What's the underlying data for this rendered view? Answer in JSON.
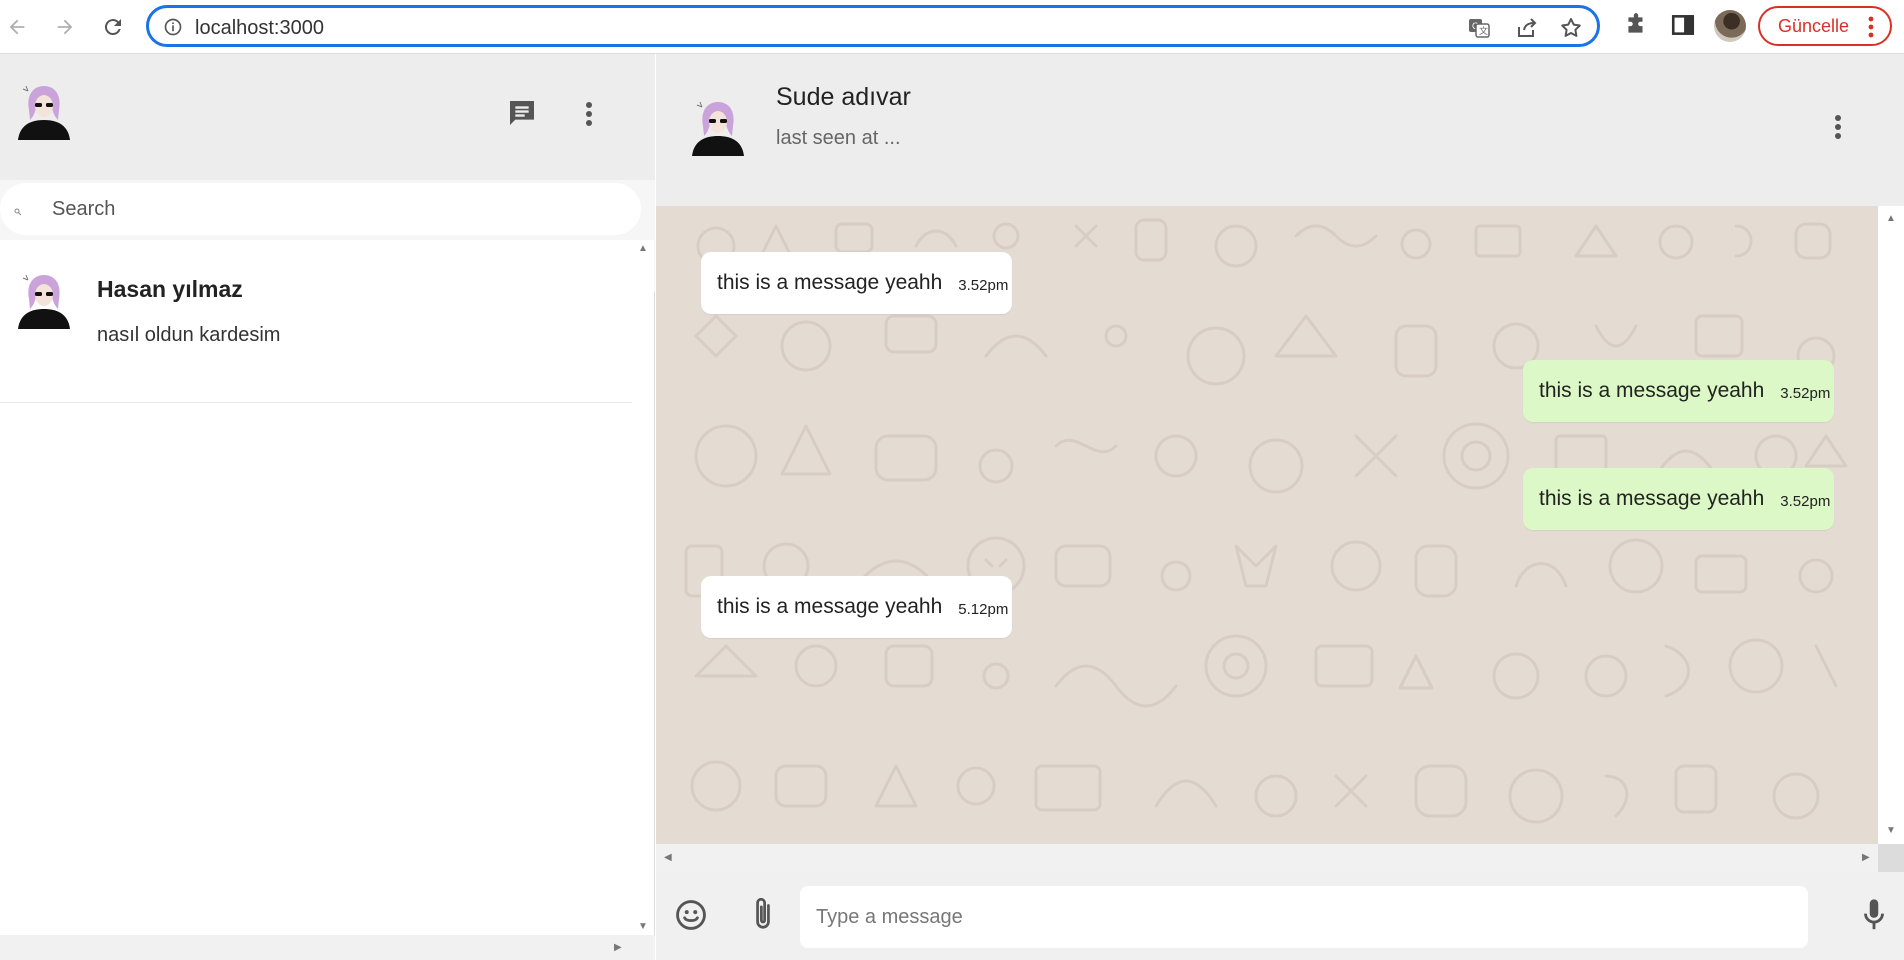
{
  "browser": {
    "url": "localhost:3000",
    "update_label": "Güncelle"
  },
  "sidebar": {
    "search_placeholder": "Search",
    "chats": [
      {
        "name": "Hasan yılmaz",
        "preview": "nasıl oldun kardesim"
      }
    ]
  },
  "chat": {
    "contact_name": "Sude adıvar",
    "contact_status": "last seen at ...",
    "messages": [
      {
        "text": "this is a message yeahh",
        "time": "3.52pm",
        "direction": "in"
      },
      {
        "text": "this is a message yeahh",
        "time": "3.52pm",
        "direction": "out"
      },
      {
        "text": "this is a message yeahh",
        "time": "3.52pm",
        "direction": "out"
      },
      {
        "text": "this is a message yeahh",
        "time": "5.12pm",
        "direction": "in"
      }
    ],
    "composer_placeholder": "Type a message"
  },
  "colors": {
    "incoming_bubble": "#ffffff",
    "outgoing_bubble": "#dcf8c6",
    "chat_background": "#e4dbd3",
    "header_background": "#ededed",
    "accent_blue": "#1a73e8",
    "update_red": "#d93025"
  },
  "icons": {
    "back": "arrow-left-icon",
    "forward": "arrow-right-icon",
    "reload": "reload-icon",
    "site_info": "info-icon",
    "translate": "translate-icon",
    "share": "share-icon",
    "bookmark": "star-icon",
    "extensions": "puzzle-icon",
    "side_panel": "side-panel-icon",
    "new_chat": "message-icon",
    "menu": "more-vert-icon",
    "emoji": "emoji-icon",
    "attach": "paperclip-icon",
    "mic": "mic-icon",
    "search": "search-icon"
  }
}
